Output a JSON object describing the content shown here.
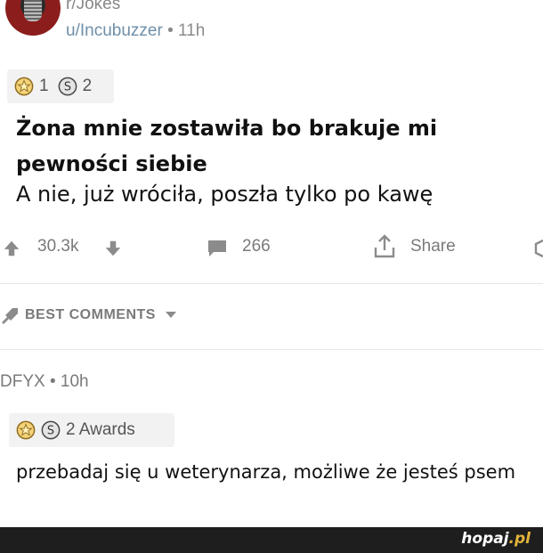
{
  "post": {
    "subreddit": "r/Jokes",
    "author": "u/Incubuzzer",
    "time": "11h",
    "awards": {
      "count_a": "1",
      "count_b": "2"
    },
    "title": "Żona mnie zostawiła bo brakuje mi pewności siebie",
    "body": "A nie, już wróciła, poszła tylko po kawę",
    "upvotes": "30.3k",
    "comments": "266",
    "share_label": "Share"
  },
  "comments_section": {
    "sort_label": "BEST COMMENTS",
    "comment": {
      "user": "DFYX",
      "time": "10h",
      "awards_label": "2 Awards",
      "text": "przebadaj się u weterynarza, możliwe że jesteś psem"
    }
  },
  "footer": {
    "logo": "hopaj",
    "logo_suffix": ".pl"
  },
  "colors": {
    "footer_bg": "#1e1e1e",
    "logo_accent": "#e2b43a",
    "meta_gray": "#7a7a7a"
  },
  "separator": "•"
}
